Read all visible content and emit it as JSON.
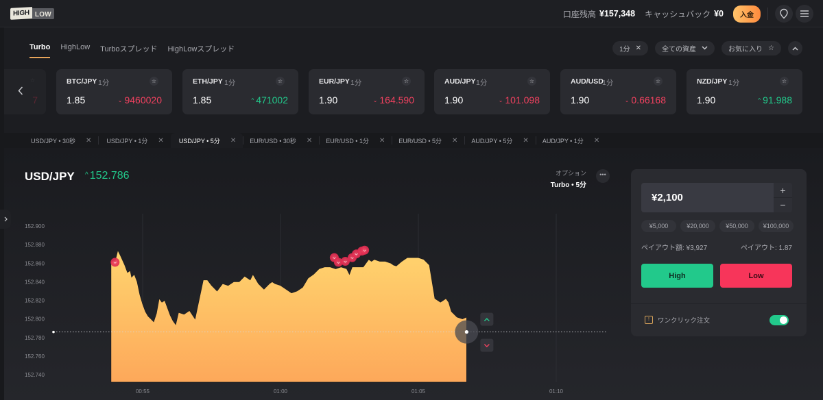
{
  "header": {
    "logo": {
      "high": "HIGH",
      "low": "LOW"
    },
    "balance_label": "口座残高",
    "balance_value": "¥157,348",
    "cashback_label": "キャッシュバック",
    "cashback_value": "¥0",
    "deposit_label": "入金",
    "icons": [
      "location-pin-icon",
      "menu-icon"
    ]
  },
  "mode_tabs": [
    {
      "label": "Turbo",
      "active": true
    },
    {
      "label": "HighLow",
      "active": false
    },
    {
      "label": "Turboスプレッド",
      "active": false
    },
    {
      "label": "HighLowスプレッド",
      "active": false
    }
  ],
  "filters": {
    "duration_chip": "1分",
    "assets_dropdown": "全ての資産",
    "favorites_chip": "お気に入り",
    "collapse_icon": "chevron-up-icon"
  },
  "asset_cards": [
    {
      "pair": "BTC/JPY",
      "duration": "1分",
      "payout": "1.85",
      "price": "9460020",
      "direction": "down"
    },
    {
      "pair": "ETH/JPY",
      "duration": "1分",
      "payout": "1.85",
      "price": "471002",
      "direction": "up"
    },
    {
      "pair": "EUR/JPY",
      "duration": "1分",
      "payout": "1.90",
      "price": "164.590",
      "direction": "down"
    },
    {
      "pair": "AUD/JPY",
      "duration": "1分",
      "payout": "1.90",
      "price": "101.098",
      "direction": "down"
    },
    {
      "pair": "AUD/USD",
      "duration": "1分",
      "payout": "1.90",
      "price": "0.66168",
      "direction": "down"
    },
    {
      "pair": "NZD/JPY",
      "duration": "1分",
      "payout": "1.90",
      "price": "91.988",
      "direction": "up"
    }
  ],
  "partial_card_price_fragment": "7",
  "asset_tabs": [
    {
      "label": "USD/JPY • 30秒",
      "active": false
    },
    {
      "label": "USD/JPY • 1分",
      "active": false
    },
    {
      "label": "USD/JPY • 5分",
      "active": true
    },
    {
      "label": "EUR/USD • 30秒",
      "active": false
    },
    {
      "label": "EUR/USD • 1分",
      "active": false
    },
    {
      "label": "EUR/USD • 5分",
      "active": false
    },
    {
      "label": "AUD/JPY • 5分",
      "active": false
    },
    {
      "label": "AUD/JPY • 1分",
      "active": false
    }
  ],
  "instrument": {
    "symbol": "USD/JPY",
    "price": "152.786",
    "direction": "up",
    "option_label": "オプション",
    "option_value": "Turbo • 5分"
  },
  "trade_panel": {
    "amount": "¥2,100",
    "plus": "+",
    "minus": "−",
    "presets": [
      "¥5,000",
      "¥20,000",
      "¥50,000",
      "¥100,000"
    ],
    "payout_amount": "ペイアウト額: ¥3,927",
    "payout_rate": "ペイアウト: 1.87",
    "high_label": "High",
    "low_label": "Low",
    "one_click_label": "ワンクリック注文",
    "one_click_enabled": true
  },
  "colors": {
    "up": "#22c98b",
    "down": "#f0415f",
    "accent": "#e8a55a",
    "area_top": "#ffd46e",
    "area_bottom": "#fda85a"
  },
  "chart_data": {
    "type": "area",
    "title": "USD/JPY",
    "xlabel": "",
    "ylabel": "",
    "y_ticks": [
      "152.900",
      "152.880",
      "152.860",
      "152.840",
      "152.820",
      "152.800",
      "152.780",
      "152.760",
      "152.740"
    ],
    "x_ticks": [
      "00:55",
      "01:00",
      "01:05",
      "01:10"
    ],
    "ylim": [
      152.732,
      152.912
    ],
    "xlim_minutes": [
      53.2,
      71.5
    ],
    "grid": "vertical",
    "current_price": 152.786,
    "series": [
      {
        "name": "USD/JPY",
        "x_minutes": [
          53.85,
          53.86,
          54.0,
          54.1,
          54.2,
          54.35,
          54.45,
          54.55,
          54.6,
          54.7,
          54.8,
          54.9,
          55.0,
          55.1,
          55.2,
          55.3,
          55.4,
          55.5,
          55.6,
          55.7,
          55.8,
          55.9,
          56.0,
          56.1,
          56.2,
          56.3,
          56.5,
          56.7,
          56.9,
          57.1,
          57.2,
          57.35,
          57.5,
          57.7,
          57.9,
          58.1,
          58.3,
          58.5,
          58.7,
          58.9,
          59.0,
          59.2,
          59.4,
          59.6,
          59.7,
          59.8,
          60.0,
          60.2,
          60.4,
          60.6,
          60.8,
          61.0,
          61.2,
          61.4,
          61.6,
          61.8,
          62.0,
          62.2,
          62.4,
          62.5,
          62.6,
          62.8,
          63.0,
          63.2,
          63.3,
          63.4,
          63.6,
          63.8,
          64.0,
          64.1,
          64.2,
          64.4,
          64.6,
          64.8,
          65.0,
          65.2,
          65.4,
          65.6,
          65.8,
          65.9,
          66.0,
          66.1,
          66.2,
          66.4,
          66.6,
          66.75
        ],
        "values": [
          152.863,
          152.862,
          152.862,
          152.874,
          152.868,
          152.858,
          152.85,
          152.852,
          152.845,
          152.848,
          152.84,
          152.826,
          152.816,
          152.808,
          152.803,
          152.8,
          152.797,
          152.806,
          152.822,
          152.818,
          152.82,
          152.812,
          152.804,
          152.798,
          152.794,
          152.807,
          152.805,
          152.809,
          152.8,
          152.828,
          152.842,
          152.842,
          152.836,
          152.83,
          152.838,
          152.836,
          152.84,
          152.84,
          152.846,
          152.842,
          152.848,
          152.838,
          152.832,
          152.838,
          152.84,
          152.838,
          152.836,
          152.832,
          152.828,
          152.83,
          152.834,
          152.844,
          152.848,
          152.854,
          152.856,
          152.856,
          152.854,
          152.856,
          152.854,
          152.848,
          152.856,
          152.856,
          152.856,
          152.864,
          152.862,
          152.864,
          152.862,
          152.862,
          152.86,
          152.858,
          152.857,
          152.862,
          152.866,
          152.866,
          152.866,
          152.864,
          152.858,
          152.822,
          152.818,
          152.82,
          152.822,
          152.818,
          152.808,
          152.802,
          152.8,
          152.802
        ]
      }
    ],
    "markers": [
      {
        "type": "low-trade",
        "x_minutes": 54.0,
        "value": 152.861
      },
      {
        "type": "low-trade",
        "x_minutes": 61.95,
        "value": 152.866
      },
      {
        "type": "low-trade",
        "x_minutes": 62.1,
        "value": 152.861
      },
      {
        "type": "low-trade",
        "x_minutes": 62.35,
        "value": 152.862
      },
      {
        "type": "low-trade",
        "x_minutes": 62.6,
        "value": 152.866
      },
      {
        "type": "low-trade",
        "x_minutes": 62.75,
        "value": 152.87
      },
      {
        "type": "low-trade",
        "x_minutes": 62.95,
        "value": 152.873
      },
      {
        "type": "low-trade",
        "x_minutes": 63.05,
        "value": 152.874
      }
    ]
  }
}
